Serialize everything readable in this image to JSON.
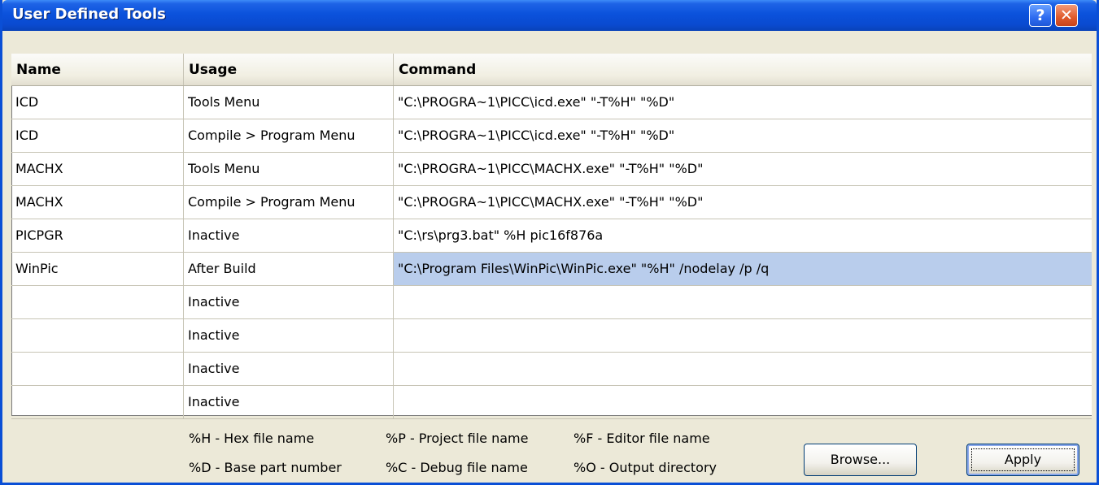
{
  "window": {
    "title": "User Defined Tools",
    "help_label": "?",
    "close_label": "✕"
  },
  "grid": {
    "columns": [
      "Name",
      "Usage",
      "Command"
    ],
    "rows": [
      {
        "name": "ICD",
        "usage": "Tools Menu",
        "command": "\"C:\\PROGRA~1\\PICC\\icd.exe\" \"-T%H\" \"%D\""
      },
      {
        "name": "ICD",
        "usage": "Compile > Program Menu",
        "command": "\"C:\\PROGRA~1\\PICC\\icd.exe\" \"-T%H\" \"%D\""
      },
      {
        "name": "MACHX",
        "usage": "Tools Menu",
        "command": "\"C:\\PROGRA~1\\PICC\\MACHX.exe\" \"-T%H\" \"%D\""
      },
      {
        "name": "MACHX",
        "usage": "Compile > Program Menu",
        "command": "\"C:\\PROGRA~1\\PICC\\MACHX.exe\" \"-T%H\" \"%D\""
      },
      {
        "name": "PICPGR",
        "usage": "Inactive",
        "command": "\"C:\\rs\\prg3.bat\" %H pic16f876a"
      },
      {
        "name": "WinPic",
        "usage": "After Build",
        "command": "\"C:\\Program Files\\WinPic\\WinPic.exe\" \"%H\" /nodelay /p /q"
      },
      {
        "name": "",
        "usage": "Inactive",
        "command": ""
      },
      {
        "name": "",
        "usage": "Inactive",
        "command": ""
      },
      {
        "name": "",
        "usage": "Inactive",
        "command": ""
      },
      {
        "name": "",
        "usage": "Inactive",
        "command": ""
      }
    ],
    "selected_row_index": 5
  },
  "legend": {
    "hex": "%H - Hex file name",
    "part": "%D - Base part number",
    "project": "%P - Project file name",
    "debug": "%C - Debug file name",
    "editor": "%F - Editor file name",
    "output": "%O - Output directory"
  },
  "buttons": {
    "browse": "Browse...",
    "apply": "Apply"
  },
  "colors": {
    "title_bar": "#0b52dc",
    "selection": "#b9cdec",
    "dialog_bg": "#ece9d8"
  }
}
